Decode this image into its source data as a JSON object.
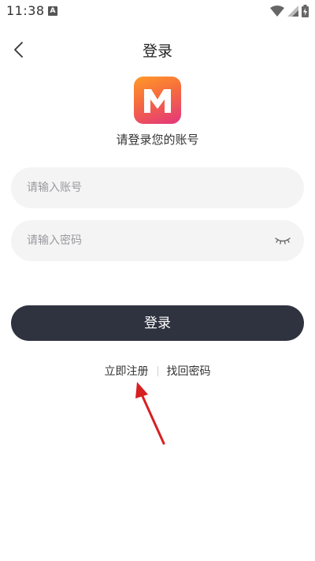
{
  "status_bar": {
    "time": "11:38",
    "notification_icon": "A"
  },
  "header": {
    "title": "登录"
  },
  "logo": {
    "letter": "M"
  },
  "subtitle": "请登录您的账号",
  "form": {
    "account_placeholder": "请输入账号",
    "password_placeholder": "请输入密码"
  },
  "login_button_label": "登录",
  "links": {
    "register": "立即注册",
    "forgot_password": "找回密码"
  },
  "colors": {
    "button_bg": "#2f3340",
    "input_bg": "#f4f4f5",
    "logo_gradient_start": "#ff9a28",
    "logo_gradient_end": "#e3357e",
    "annotation_arrow": "#d62020"
  },
  "icons": {
    "back": "chevron-left-icon",
    "password_toggle": "eye-closed-icon",
    "wifi": "wifi-icon",
    "signal": "signal-icon",
    "battery": "battery-charging-icon"
  }
}
